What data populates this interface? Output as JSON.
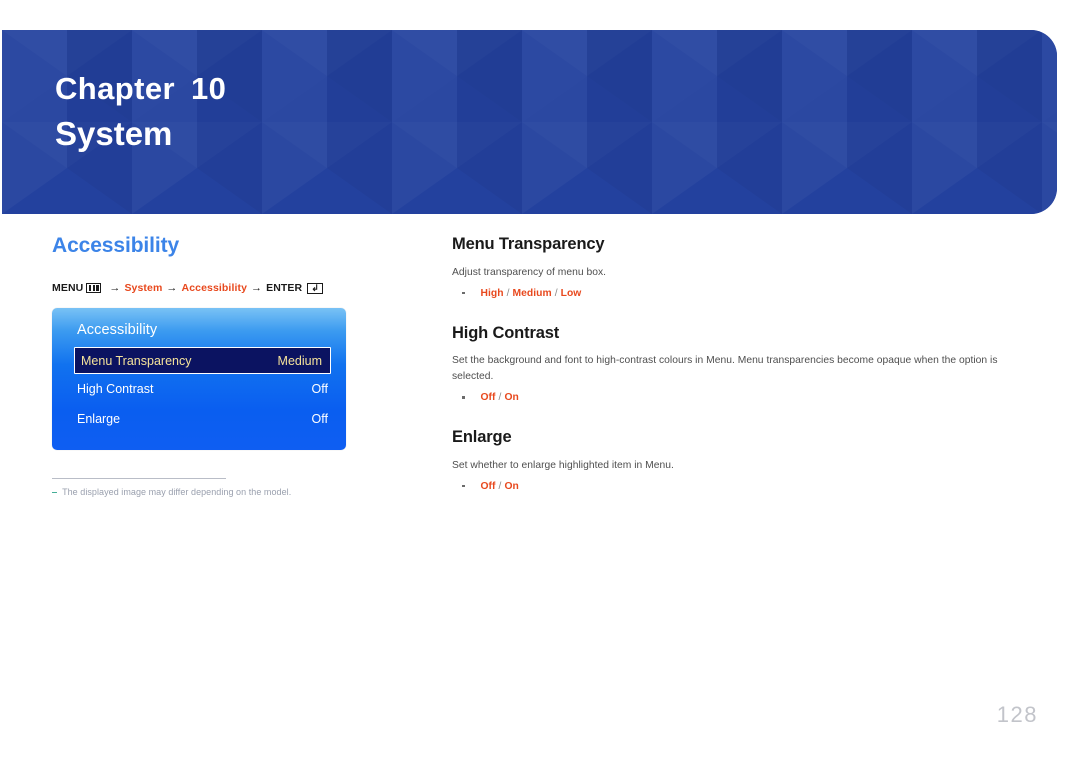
{
  "banner": {
    "chapter_label": "Chapter",
    "chapter_number": "10",
    "chapter_title": "System",
    "background_color": "#23419e"
  },
  "left": {
    "section_heading": "Accessibility",
    "heading_color": "#3c84e8",
    "menu_path": {
      "menu_label": "MENU",
      "menu_icon": "menu-bars-icon",
      "arrow1": "→",
      "step1": "System",
      "arrow2": "→",
      "step2": "Accessibility",
      "arrow3": "→",
      "enter_label": "ENTER",
      "enter_icon": "enter-return-icon",
      "highlight_color": "#e8491e"
    },
    "osd": {
      "title": "Accessibility",
      "rows": [
        {
          "label": "Menu Transparency",
          "value": "Medium",
          "selected": true
        },
        {
          "label": "High Contrast",
          "value": "Off",
          "selected": false
        },
        {
          "label": "Enlarge",
          "value": "Off",
          "selected": false
        }
      ]
    },
    "footnote": {
      "marker": "‒",
      "text": "The displayed image may differ depending on the model."
    }
  },
  "right": {
    "topics": [
      {
        "title": "Menu Transparency",
        "description": "Adjust transparency of menu box.",
        "options": [
          "High",
          "Medium",
          "Low"
        ],
        "separator": "/"
      },
      {
        "title": "High Contrast",
        "description": "Set the background and font to high-contrast colours in Menu. Menu transparencies become opaque when the option is selected.",
        "options": [
          "Off",
          "On"
        ],
        "separator": "/"
      },
      {
        "title": "Enlarge",
        "description": "Set whether to enlarge highlighted item in Menu.",
        "options": [
          "Off",
          "On"
        ],
        "separator": "/"
      }
    ]
  },
  "page_number": "128"
}
